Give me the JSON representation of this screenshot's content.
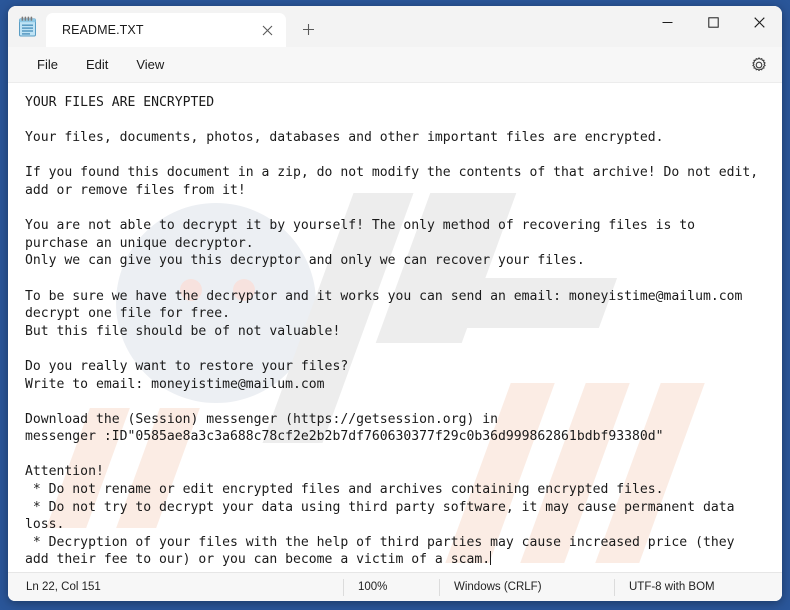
{
  "window": {
    "app_icon": "notepad-icon",
    "minimize_label": "—",
    "maximize_label": "☐",
    "close_label": "✕"
  },
  "tab": {
    "title": "README.TXT",
    "close_label": "✕",
    "new_tab_label": "+"
  },
  "menubar": {
    "items": [
      {
        "label": "File"
      },
      {
        "label": "Edit"
      },
      {
        "label": "View"
      }
    ],
    "settings_icon": "gear-icon"
  },
  "document": {
    "body": "YOUR FILES ARE ENCRYPTED\n\nYour files, documents, photos, databases and other important files are encrypted.\n\nIf you found this document in a zip, do not modify the contents of that archive! Do not edit,\nadd or remove files from it!\n\nYou are not able to decrypt it by yourself! The only method of recovering files is to\npurchase an unique decryptor.\nOnly we can give you this decryptor and only we can recover your files.\n\nTo be sure we have the decryptor and it works you can send an email: moneyistime@mailum.com\ndecrypt one file for free.\nBut this file should be of not valuable!\n\nDo you really want to restore your files?\nWrite to email: moneyistime@mailum.com\n\nDownload the (Session) messenger (https://getsession.org) in\nmessenger :ID\"0585ae8a3c3a688c78cf2e2b2b7df760630377f29c0b36d999862861bdbf93380d\"\n\nAttention!\n * Do not rename or edit encrypted files and archives containing encrypted files.\n * Do not try to decrypt your data using third party software, it may cause permanent data\nloss.\n * Decryption of your files with the help of third parties may cause increased price (they\nadd their fee to our) or you can become a victim of a scam.",
    "email": "moneyistime@mailum.com",
    "session_url": "https://getsession.org",
    "session_id": "0585ae8a3c3a688c78cf2e2b2b7df760630377f29c0b36d999862861bdbf93380d"
  },
  "statusbar": {
    "position": "Ln 22, Col 151",
    "zoom": "100%",
    "line_ending": "Windows (CRLF)",
    "encoding": "UTF-8 with BOM"
  },
  "colors": {
    "desktop": "#2a5699",
    "window_bg": "#f7f7f7",
    "editor_bg": "#ffffff",
    "text": "#1a1a1a",
    "accent": "#2a5699"
  }
}
